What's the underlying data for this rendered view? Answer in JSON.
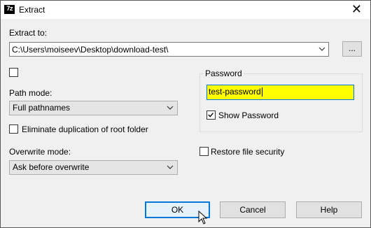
{
  "window": {
    "title": "Extract",
    "icon_text": "7z"
  },
  "extract_to": {
    "label": "Extract to:",
    "path": "C:\\Users\\moiseev\\Desktop\\download-test\\",
    "browse_label": "..."
  },
  "path_mode": {
    "label": "Path mode:",
    "value": "Full pathnames"
  },
  "eliminate_duplication": {
    "label": "Eliminate duplication of root folder",
    "checked": false
  },
  "overwrite_mode": {
    "label": "Overwrite mode:",
    "value": "Ask before overwrite"
  },
  "password": {
    "group_label": "Password",
    "value": "test-password",
    "show_label": "Show Password",
    "show_checked": true
  },
  "restore_security": {
    "label": "Restore file security",
    "checked": false
  },
  "buttons": {
    "ok": "OK",
    "cancel": "Cancel",
    "help": "Help"
  },
  "colors": {
    "accent": "#0078d7",
    "password_bg": "#ffff00"
  }
}
